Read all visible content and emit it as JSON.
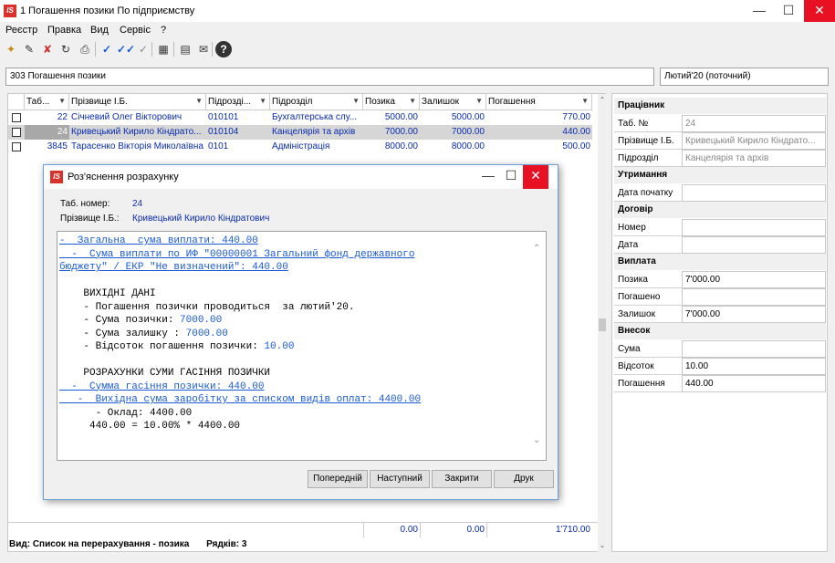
{
  "window": {
    "title": "1 Погашення позики По підприємству",
    "logo": "IS"
  },
  "menu": [
    "Реєстр",
    "Правка",
    "Вид",
    "Сервіс",
    "?"
  ],
  "toolbar": [
    "new-doc-icon",
    "edit-doc-icon",
    "delete-doc-icon",
    "refresh-icon",
    "print-icon",
    "check-icon",
    "check-all-icon",
    "uncheck-icon",
    "calculator-icon",
    "document-icon",
    "mail-icon",
    "help-icon"
  ],
  "filter": {
    "document": "303 Погашення позики",
    "period": "Лютий'20 (поточний)"
  },
  "grid": {
    "columns": [
      "Таб...",
      "Прізвище І.Б.",
      "Підрозді...",
      "Підрозділ",
      "Позика",
      "Залишок",
      "Погашення"
    ],
    "rows": [
      {
        "tab": "22",
        "name": "Січневий Олег Вікторович",
        "code": "010101",
        "dept": "Бухгалтерська слу...",
        "loan": "5000.00",
        "rest": "5000.00",
        "pay": "770.00"
      },
      {
        "tab": "24",
        "name": "Кривецький Кирило Кіндрато...",
        "code": "010104",
        "dept": "Канцелярія та архів",
        "loan": "7000.00",
        "rest": "7000.00",
        "pay": "440.00"
      },
      {
        "tab": "3845",
        "name": "Тарасенко Вікторія Миколаївна",
        "code": "0101",
        "dept": "Адміністрація",
        "loan": "8000.00",
        "rest": "8000.00",
        "pay": "500.00"
      }
    ],
    "totals": {
      "loan": "0.00",
      "rest": "0.00",
      "pay": "1'710.00"
    }
  },
  "status": {
    "view": "Вид: Список на перерахування - позика",
    "rows": "Рядків: 3"
  },
  "panel": {
    "worker_title": "Працівник",
    "tab_label": "Таб. №",
    "tab_value": "24",
    "name_label": "Прізвище І.Б.",
    "name_value": "Кривецький Кирило Кіндрато...",
    "dept_label": "Підрозділ",
    "dept_value": "Канцелярія та архів",
    "hold_title": "Утримання",
    "start_label": "Дата початку",
    "start_value": "",
    "contract_title": "Договір",
    "number_label": "Номер",
    "number_value": "",
    "date_label": "Дата",
    "date_value": "",
    "payment_title": "Виплата",
    "loan_label": "Позика",
    "loan_value": "7'000.00",
    "repaid_label": "Погашено",
    "repaid_value": "",
    "rest_label": "Залишок",
    "rest_value": "7'000.00",
    "deposit_title": "Внесок",
    "sum_label": "Сума",
    "sum_value": "",
    "pct_label": "Відсоток",
    "pct_value": "10.00",
    "pay_label": "Погашення",
    "pay_value": "440.00"
  },
  "dialog": {
    "title": "Роз'яснення розрахунку",
    "tab_label": "Таб. номер:",
    "tab_value": "24",
    "name_label": "Прізвище І.Б.:",
    "name_value": "Кривецький Кирило Кіндратович",
    "lines": {
      "l1": "-  Загальна  сума виплати: 440.00",
      "l2": "  -  Сума виплати по ИФ \"00000001 Загальний фонд державного",
      "l3": "бюджету\" / ЕКР \"Не визначений\": 440.00",
      "l4": "    ВИХІДНІ ДАНІ",
      "l5a": "    - Погашення позички проводиться  за лютий'20.",
      "l6a": "    - Сума позички: ",
      "l6b": "7000.00",
      "l7a": "    - Сума залишку : ",
      "l7b": "7000.00",
      "l8a": "    - Відсоток погашення позички: ",
      "l8b": "10.00",
      "l9": "    РОЗРАХУНКИ СУМИ ГАСІННЯ ПОЗИЧКИ",
      "l10": "  -  Сумма гасіння позички: 440.00",
      "l11": "   -  Вихідна сума заробітку за списком видів оплат: 4400.00",
      "l12": "      - Оклад: 4400.00",
      "l13": "     440.00 = 10.00% * 4400.00"
    },
    "buttons": {
      "prev": "Попередній",
      "next": "Наступний",
      "close": "Закрити",
      "print": "Друк"
    }
  }
}
